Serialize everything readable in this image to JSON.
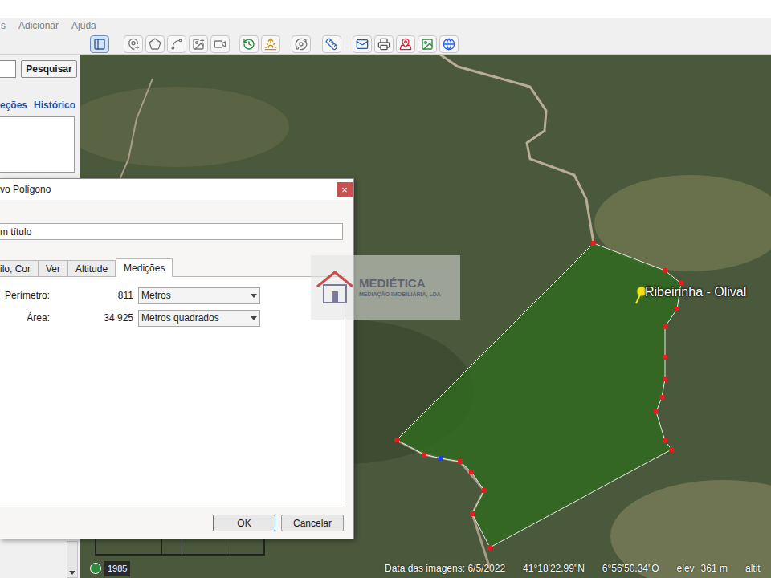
{
  "menu": [
    {
      "label": "s"
    },
    {
      "label": "Adicionar"
    },
    {
      "label": "Ajuda"
    }
  ],
  "toolbar": {
    "sidebar_toggle_pressed": true
  },
  "search": {
    "value": "",
    "button": "Pesquisar"
  },
  "panel_tabs": [
    {
      "label": "eções"
    },
    {
      "label": "Histórico"
    }
  ],
  "dialog": {
    "title": "vo Polígono",
    "close": "×",
    "name": "m título",
    "tabs": [
      {
        "label": "ilo, Cor",
        "selected": false
      },
      {
        "label": "Ver",
        "selected": false
      },
      {
        "label": "Altitude",
        "selected": false
      },
      {
        "label": "Medições",
        "selected": true
      }
    ],
    "measurements": [
      {
        "label": "Perímetro:",
        "value": "811",
        "unit": "Metros"
      },
      {
        "label": "Área:",
        "value": "34 925",
        "unit": "Metros quadrados"
      }
    ],
    "buttons": [
      {
        "label": "OK",
        "default": true
      },
      {
        "label": "Cancelar",
        "default": false
      }
    ]
  },
  "watermark": {
    "name": "MEDIÉTICA",
    "subtitle": "MEDIAÇÃO IMOBILIÁRIA, LDA"
  },
  "map": {
    "placemark": "Ribeirinha - Olival",
    "year": "1985"
  },
  "status_bar": {
    "date": "Data das imagens: 6/5/2022",
    "lat": "41°18'22.99\"N",
    "lon": "6°56'50.34\"O",
    "elev_label": "elev",
    "elev": "361 m",
    "alt": "altit"
  }
}
